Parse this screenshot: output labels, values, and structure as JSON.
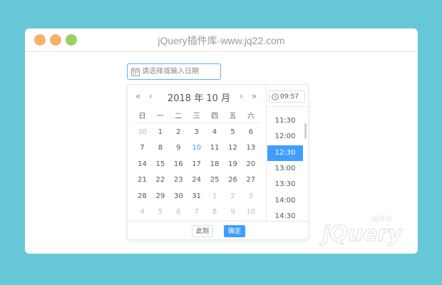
{
  "window": {
    "title": "jQuery插件库-www.jq22.com"
  },
  "date_input": {
    "placeholder": "请选择或输入日期",
    "icon": "calendar-icon"
  },
  "calendar": {
    "nav": {
      "prev_year": "«",
      "prev_month": "‹",
      "next_month": "›",
      "next_year": "»"
    },
    "title": "2018 年 10 月",
    "weekdays": [
      "日",
      "一",
      "二",
      "三",
      "四",
      "五",
      "六"
    ],
    "weeks": [
      [
        {
          "d": "30",
          "other": true
        },
        {
          "d": "1"
        },
        {
          "d": "2"
        },
        {
          "d": "3"
        },
        {
          "d": "4"
        },
        {
          "d": "5"
        },
        {
          "d": "6"
        }
      ],
      [
        {
          "d": "7"
        },
        {
          "d": "8"
        },
        {
          "d": "9"
        },
        {
          "d": "10",
          "today": true
        },
        {
          "d": "11"
        },
        {
          "d": "12"
        },
        {
          "d": "13"
        }
      ],
      [
        {
          "d": "14"
        },
        {
          "d": "15"
        },
        {
          "d": "16"
        },
        {
          "d": "17"
        },
        {
          "d": "18"
        },
        {
          "d": "19"
        },
        {
          "d": "20"
        }
      ],
      [
        {
          "d": "21"
        },
        {
          "d": "22"
        },
        {
          "d": "23"
        },
        {
          "d": "24"
        },
        {
          "d": "25"
        },
        {
          "d": "26"
        },
        {
          "d": "27"
        }
      ],
      [
        {
          "d": "28"
        },
        {
          "d": "29"
        },
        {
          "d": "30"
        },
        {
          "d": "31"
        },
        {
          "d": "1",
          "other": true
        },
        {
          "d": "2",
          "other": true
        },
        {
          "d": "3",
          "other": true
        }
      ],
      [
        {
          "d": "4",
          "other": true
        },
        {
          "d": "5",
          "other": true
        },
        {
          "d": "6",
          "other": true
        },
        {
          "d": "7",
          "other": true
        },
        {
          "d": "8",
          "other": true
        },
        {
          "d": "9",
          "other": true
        },
        {
          "d": "10",
          "other": true
        }
      ]
    ]
  },
  "time": {
    "value": "09:57",
    "icon": "clock-icon",
    "items": [
      {
        "label": "11:30"
      },
      {
        "label": "12:00"
      },
      {
        "label": "12:30",
        "selected": true
      },
      {
        "label": "13:00"
      },
      {
        "label": "13:30"
      },
      {
        "label": "14:00"
      },
      {
        "label": "14:30"
      }
    ]
  },
  "footer": {
    "now_label": "此刻",
    "ok_label": "确定"
  },
  "colors": {
    "accent": "#409eff",
    "background": "#66c8d7"
  }
}
